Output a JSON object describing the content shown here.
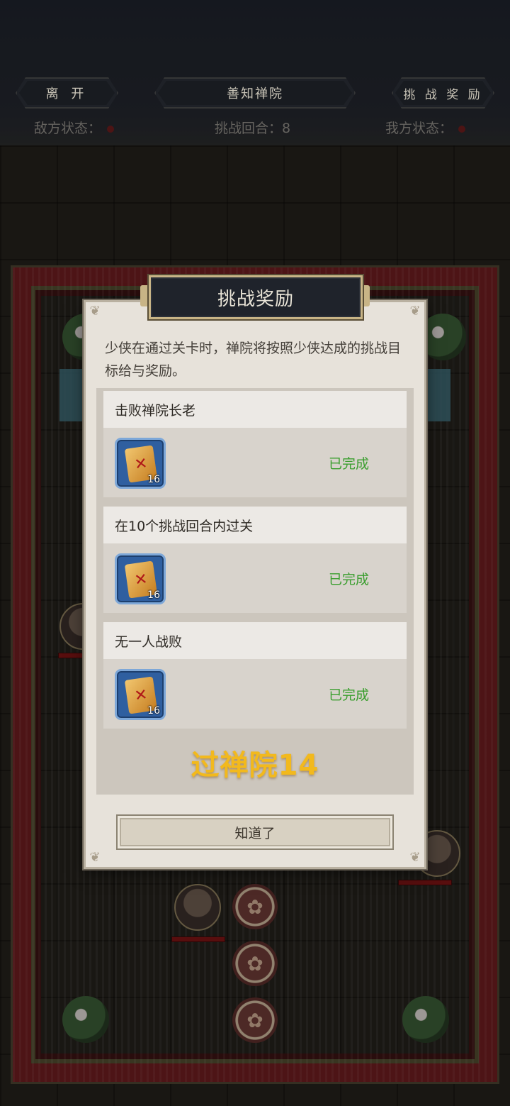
{
  "hud": {
    "leave_label": "离 开",
    "stage_title": "善知禅院",
    "reward_label": "挑 战 奖 励",
    "enemy_status_label": "敌方状态：",
    "round_label": "挑战回合：8",
    "ally_status_label": "我方状态："
  },
  "dialog": {
    "title": "挑战奖励",
    "intro": "少侠在通过关卡时，禅院将按照少侠达成的挑战目标给与奖励。",
    "tasks": [
      {
        "name": "击败禅院长老",
        "reward_icon": "talisman-icon",
        "reward_count": "16",
        "status": "已完成"
      },
      {
        "name": "在10个挑战回合内过关",
        "reward_icon": "talisman-icon",
        "reward_count": "16",
        "status": "已完成"
      },
      {
        "name": "无一人战败",
        "reward_icon": "talisman-icon",
        "reward_count": "16",
        "status": "已完成"
      }
    ],
    "result": "过禅院14",
    "confirm_label": "知道了"
  },
  "colors": {
    "status_done": "#3a9e2e",
    "result_text": "#f2b91d",
    "wall_red": "#6b1d1f"
  }
}
